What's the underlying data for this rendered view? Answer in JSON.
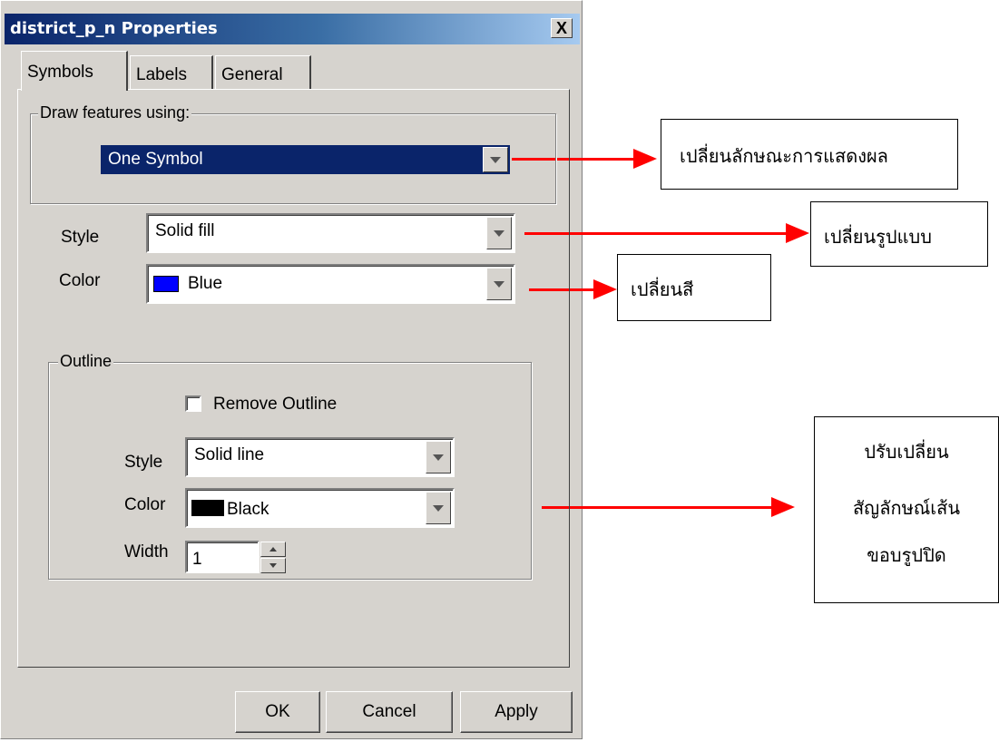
{
  "window": {
    "title": "district_p_n Properties",
    "close_label": "X"
  },
  "tabs": [
    {
      "label": "Symbols"
    },
    {
      "label": "Labels"
    },
    {
      "label": "General"
    }
  ],
  "draw_group": {
    "legend": "Draw features using:",
    "value": "One Symbol"
  },
  "fill": {
    "style_label": "Style",
    "style_value": "Solid fill",
    "color_label": "Color",
    "color_value": "Blue",
    "color_swatch": "#0000ff"
  },
  "outline": {
    "legend": "Outline",
    "remove_label": "Remove Outline",
    "remove_checked": false,
    "style_label": "Style",
    "style_value": "Solid line",
    "color_label": "Color",
    "color_value": "Black",
    "color_swatch": "#000000",
    "width_label": "Width",
    "width_value": "1"
  },
  "buttons": {
    "ok": "OK",
    "cancel": "Cancel",
    "apply": "Apply"
  },
  "annotations": {
    "draw_mode": "เปลี่ยนลักษณะการแสดงผล",
    "style": "เปลี่ยนรูปแบบ",
    "color": "เปลี่ยนสี",
    "outline_lines": [
      "ปรับเปลี่ยน",
      "สัญลักษณ์เส้น",
      "ขอบรูปปิด"
    ]
  },
  "colors": {
    "arrow": "#ff0000",
    "title_bar": "#0a246a",
    "dialog_bg": "#d6d3ce"
  }
}
